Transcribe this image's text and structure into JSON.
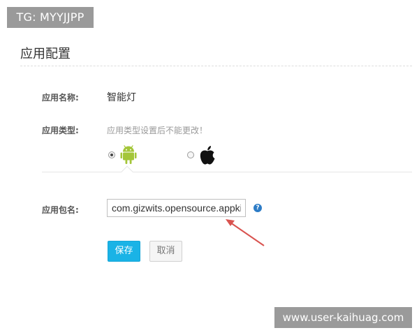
{
  "watermarks": {
    "top_left": "TG: MYYJJPP",
    "bottom_right": "www.user-kaihuag.com"
  },
  "section": {
    "title": "应用配置"
  },
  "form": {
    "name_label": "应用名称:",
    "name_value": "智能灯",
    "type_label": "应用类型:",
    "type_hint": "应用类型设置后不能更改！",
    "type_options": [
      {
        "name": "android",
        "icon": "android-icon",
        "selected": true
      },
      {
        "name": "apple",
        "icon": "apple-icon",
        "selected": false
      }
    ],
    "package_label": "应用包名:",
    "package_value": "com.gizwits.opensource.appkit",
    "help_icon": "?"
  },
  "buttons": {
    "save": "保存",
    "cancel": "取消"
  },
  "colors": {
    "primary_button": "#1ab3e6",
    "android_green": "#a4c639",
    "annotation_arrow": "#d9534f",
    "help_icon": "#2d7cc6"
  }
}
